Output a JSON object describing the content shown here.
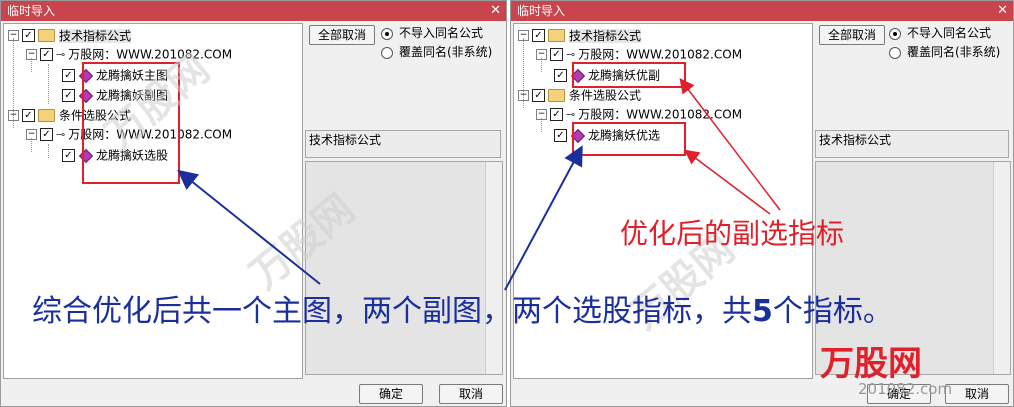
{
  "dialog": {
    "title": "临时导入",
    "close_glyph": "✕",
    "deselect_label": "全部取消",
    "radio_no_import": "不导入同名公式",
    "radio_overwrite": "覆盖同名(非系统)",
    "panel_label": "技术指标公式",
    "ok_label": "确定",
    "cancel_label": "取消"
  },
  "left_tree": {
    "root1": "技术指标公式",
    "site1": "万股网：WWW.201082.COM",
    "item1": "龙腾擒妖主图",
    "item2": "龙腾擒妖副图",
    "root2": "条件选股公式",
    "site2": "万股网：WWW.201082.COM",
    "item3": "龙腾擒妖选股"
  },
  "right_tree": {
    "root1": "技术指标公式",
    "site1": "万股网：WWW.201082.COM",
    "item1": "龙腾擒妖优副",
    "root2": "条件选股公式",
    "site2": "万股网：WWW.201082.COM",
    "item2": "龙腾擒妖优选"
  },
  "annotations": {
    "main_caption_a": "综合优化后共一个主图，两个副图，两个选股指标，共",
    "main_caption_b": "5",
    "main_caption_c": "个指标。",
    "red_caption": "优化后的副选指标"
  },
  "watermark": {
    "brand": "万股网",
    "site": "201082.com"
  },
  "colors": {
    "titlebar": "#c9444c",
    "annotation_red": "#e0202a",
    "caption_blue": "#1b2f9c",
    "gem": "#b43ab4"
  }
}
